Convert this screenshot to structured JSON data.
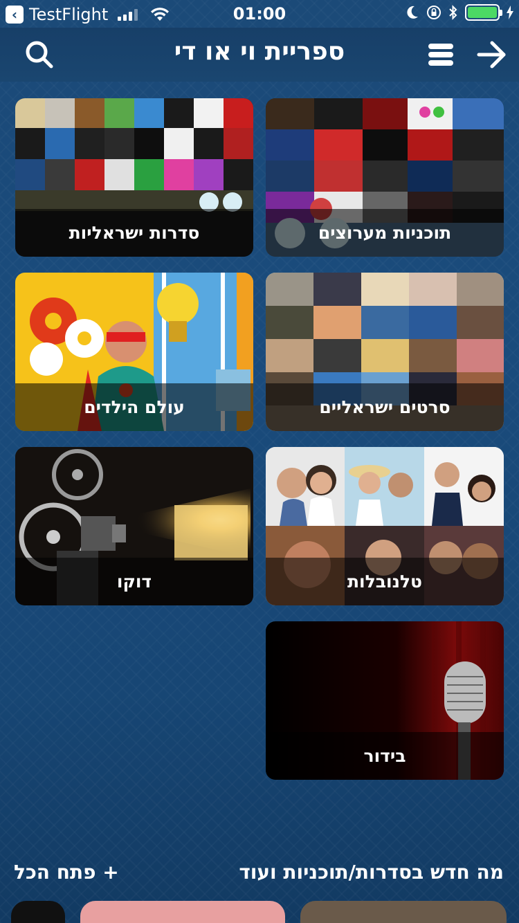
{
  "status": {
    "carrier": "TestFlight",
    "time": "01:00"
  },
  "nav": {
    "title": "ספריית וי או די",
    "search_icon": "search-icon",
    "menu_icon": "menu-icon",
    "forward_icon": "arrow-right-icon"
  },
  "tiles": [
    {
      "label": "תוכניות מערוצים"
    },
    {
      "label": "סדרות ישראליות"
    },
    {
      "label": "סרטים ישראליים"
    },
    {
      "label": "עולם הילדים"
    },
    {
      "label": "טלנובלות"
    },
    {
      "label": "דוקו"
    },
    {
      "label": "בידור"
    }
  ],
  "bottom": {
    "whats_new": "מה חדש בסדרות/תוכניות ועוד",
    "open_all": "+ פתח הכל"
  },
  "colors": {
    "background": "#1a4b7c",
    "battery": "#4cd964"
  }
}
